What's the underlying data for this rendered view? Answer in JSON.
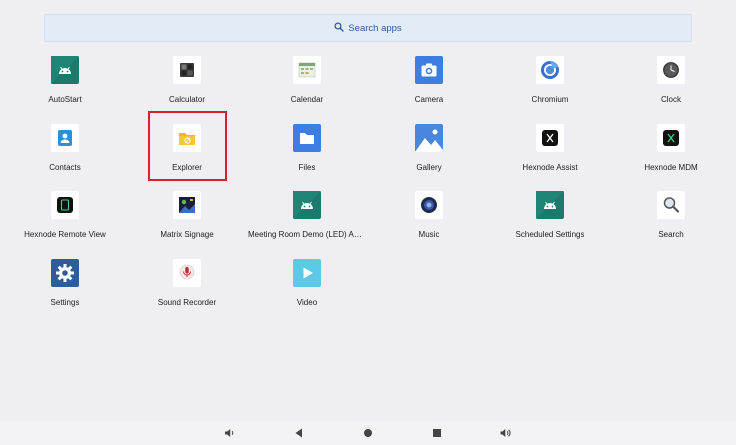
{
  "search": {
    "label": "Search apps",
    "icon": "search-icon"
  },
  "apps": [
    {
      "label": "AutoStart",
      "icon": "android-icon"
    },
    {
      "label": "Calculator",
      "icon": "calculator-icon"
    },
    {
      "label": "Calendar",
      "icon": "calendar-icon"
    },
    {
      "label": "Camera",
      "icon": "camera-icon"
    },
    {
      "label": "Chromium",
      "icon": "chromium-icon"
    },
    {
      "label": "Clock",
      "icon": "clock-icon"
    },
    {
      "label": "Contacts",
      "icon": "contacts-icon"
    },
    {
      "label": "Explorer",
      "icon": "folder-explorer-icon"
    },
    {
      "label": "Files",
      "icon": "files-icon"
    },
    {
      "label": "Gallery",
      "icon": "gallery-icon"
    },
    {
      "label": "Hexnode Assist",
      "icon": "hexnode-assist-icon"
    },
    {
      "label": "Hexnode MDM",
      "icon": "hexnode-mdm-icon"
    },
    {
      "label": "Hexnode Remote View",
      "icon": "hexnode-remote-view-icon"
    },
    {
      "label": "Matrix Signage",
      "icon": "matrix-signage-icon"
    },
    {
      "label": "Meeting Room Demo (LED) APP...",
      "icon": "android-icon"
    },
    {
      "label": "Music",
      "icon": "music-icon"
    },
    {
      "label": "Scheduled Settings",
      "icon": "android-icon"
    },
    {
      "label": "Search",
      "icon": "magnifier-icon"
    },
    {
      "label": "Settings",
      "icon": "settings-gear-icon"
    },
    {
      "label": "Sound Recorder",
      "icon": "microphone-icon"
    },
    {
      "label": "Video",
      "icon": "play-icon"
    }
  ],
  "selected_app": "Explorer",
  "colors": {
    "highlight": "#d9232a",
    "search_text": "#2e5b99",
    "search_bg": "#e2ecf7"
  },
  "navbar": {
    "buttons": [
      {
        "icon": "volume-down-icon"
      },
      {
        "icon": "back-icon"
      },
      {
        "icon": "home-icon"
      },
      {
        "icon": "recents-icon"
      },
      {
        "icon": "volume-up-icon"
      }
    ]
  }
}
